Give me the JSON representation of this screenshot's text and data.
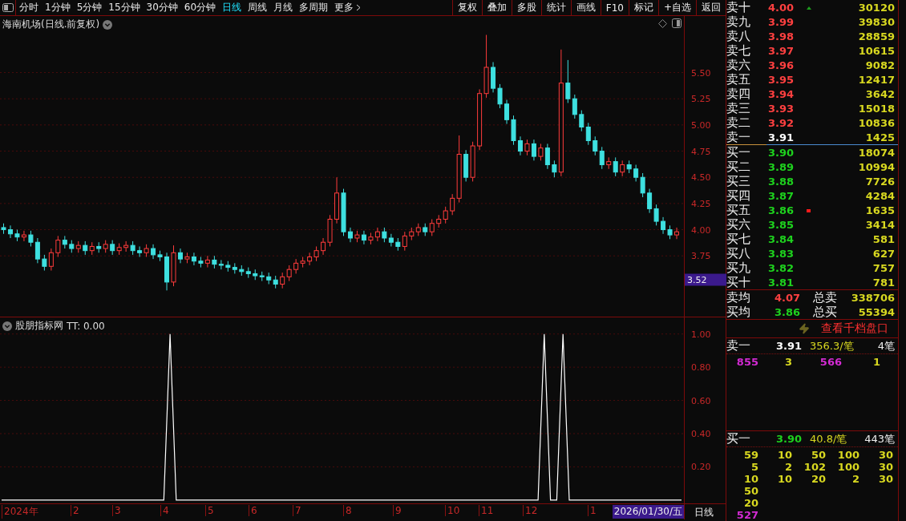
{
  "toolbar": {
    "periods": [
      {
        "label": "分时",
        "selected": false
      },
      {
        "label": "1分钟",
        "selected": false
      },
      {
        "label": "5分钟",
        "selected": false
      },
      {
        "label": "15分钟",
        "selected": false
      },
      {
        "label": "30分钟",
        "selected": false
      },
      {
        "label": "60分钟",
        "selected": false
      },
      {
        "label": "日线",
        "selected": true
      },
      {
        "label": "周线",
        "selected": false
      },
      {
        "label": "月线",
        "selected": false
      },
      {
        "label": "多周期",
        "selected": false
      },
      {
        "label": "更多",
        "selected": false
      }
    ],
    "actions": [
      "复权",
      "叠加",
      "多股",
      "统计",
      "画线",
      "F10",
      "标记",
      "+自选",
      "返回"
    ]
  },
  "main_chart": {
    "title": "海南机场(日线.前复权)",
    "current_price_label": "3.52",
    "chart_data": {
      "type": "candlestick",
      "ylim": [
        3.17,
        6.04
      ],
      "grid": true,
      "yticks": [
        {
          "value": 5.5,
          "label": "5.50"
        },
        {
          "value": 5.25,
          "label": "5.25"
        },
        {
          "value": 5,
          "label": "5.00"
        },
        {
          "value": 4.75,
          "label": "4.75"
        },
        {
          "value": 4.5,
          "label": "4.50"
        },
        {
          "value": 4.25,
          "label": "4.25"
        },
        {
          "value": 4,
          "label": "4.00"
        },
        {
          "value": 3.75,
          "label": "3.75"
        }
      ],
      "ohlc": [
        [
          4.02,
          4.06,
          3.96,
          4.0
        ],
        [
          4.0,
          4.04,
          3.92,
          3.96
        ],
        [
          3.96,
          4.0,
          3.89,
          3.93
        ],
        [
          3.93,
          3.99,
          3.89,
          3.95
        ],
        [
          3.95,
          3.99,
          3.84,
          3.88
        ],
        [
          3.88,
          3.92,
          3.68,
          3.72
        ],
        [
          3.72,
          3.76,
          3.61,
          3.65
        ],
        [
          3.65,
          3.82,
          3.61,
          3.78
        ],
        [
          3.78,
          3.94,
          3.74,
          3.9
        ],
        [
          3.9,
          3.94,
          3.82,
          3.86
        ],
        [
          3.86,
          3.9,
          3.78,
          3.82
        ],
        [
          3.82,
          3.89,
          3.78,
          3.85
        ],
        [
          3.85,
          3.89,
          3.76,
          3.8
        ],
        [
          3.8,
          3.88,
          3.76,
          3.84
        ],
        [
          3.84,
          3.88,
          3.78,
          3.82
        ],
        [
          3.82,
          3.9,
          3.78,
          3.86
        ],
        [
          3.86,
          3.9,
          3.76,
          3.8
        ],
        [
          3.8,
          3.87,
          3.76,
          3.83
        ],
        [
          3.83,
          3.89,
          3.79,
          3.85
        ],
        [
          3.85,
          3.89,
          3.76,
          3.8
        ],
        [
          3.8,
          3.84,
          3.74,
          3.78
        ],
        [
          3.78,
          3.86,
          3.74,
          3.82
        ],
        [
          3.82,
          3.86,
          3.72,
          3.76
        ],
        [
          3.76,
          3.8,
          3.7,
          3.74
        ],
        [
          3.74,
          3.78,
          3.42,
          3.5
        ],
        [
          3.5,
          3.85,
          3.46,
          3.78
        ],
        [
          3.78,
          3.82,
          3.68,
          3.72
        ],
        [
          3.72,
          3.78,
          3.68,
          3.74
        ],
        [
          3.74,
          3.78,
          3.66,
          3.7
        ],
        [
          3.7,
          3.74,
          3.64,
          3.68
        ],
        [
          3.68,
          3.75,
          3.64,
          3.71
        ],
        [
          3.71,
          3.75,
          3.63,
          3.67
        ],
        [
          3.67,
          3.71,
          3.62,
          3.66
        ],
        [
          3.66,
          3.7,
          3.6,
          3.64
        ],
        [
          3.64,
          3.68,
          3.58,
          3.62
        ],
        [
          3.62,
          3.66,
          3.56,
          3.6
        ],
        [
          3.6,
          3.64,
          3.54,
          3.58
        ],
        [
          3.58,
          3.62,
          3.52,
          3.56
        ],
        [
          3.56,
          3.6,
          3.51,
          3.55
        ],
        [
          3.55,
          3.59,
          3.48,
          3.52
        ],
        [
          3.52,
          3.56,
          3.44,
          3.48
        ],
        [
          3.48,
          3.59,
          3.44,
          3.55
        ],
        [
          3.55,
          3.66,
          3.51,
          3.62
        ],
        [
          3.62,
          3.72,
          3.58,
          3.68
        ],
        [
          3.68,
          3.74,
          3.64,
          3.7
        ],
        [
          3.7,
          3.78,
          3.66,
          3.74
        ],
        [
          3.74,
          3.84,
          3.7,
          3.8
        ],
        [
          3.8,
          3.92,
          3.76,
          3.88
        ],
        [
          3.88,
          4.14,
          3.84,
          4.1
        ],
        [
          4.1,
          4.5,
          4.06,
          4.35
        ],
        [
          4.35,
          4.39,
          3.94,
          3.98
        ],
        [
          3.98,
          4.02,
          3.88,
          3.92
        ],
        [
          3.92,
          3.99,
          3.88,
          3.95
        ],
        [
          3.95,
          3.99,
          3.86,
          3.9
        ],
        [
          3.9,
          3.97,
          3.86,
          3.93
        ],
        [
          3.93,
          4.02,
          3.89,
          3.98
        ],
        [
          3.98,
          4.02,
          3.88,
          3.92
        ],
        [
          3.92,
          3.96,
          3.84,
          3.88
        ],
        [
          3.88,
          3.92,
          3.8,
          3.84
        ],
        [
          3.84,
          3.98,
          3.8,
          3.94
        ],
        [
          3.94,
          4.02,
          3.9,
          3.98
        ],
        [
          3.98,
          4.06,
          3.94,
          4.02
        ],
        [
          4.02,
          4.06,
          3.94,
          3.98
        ],
        [
          3.98,
          4.1,
          3.94,
          4.06
        ],
        [
          4.06,
          4.14,
          4.02,
          4.1
        ],
        [
          4.1,
          4.22,
          4.06,
          4.18
        ],
        [
          4.18,
          4.34,
          4.14,
          4.3
        ],
        [
          4.3,
          4.9,
          4.26,
          4.72
        ],
        [
          4.72,
          4.76,
          4.46,
          4.5
        ],
        [
          4.5,
          4.84,
          4.46,
          4.8
        ],
        [
          4.8,
          5.34,
          4.76,
          5.3
        ],
        [
          5.3,
          5.86,
          5.26,
          5.55
        ],
        [
          5.55,
          5.6,
          5.31,
          5.35
        ],
        [
          5.35,
          5.39,
          5.16,
          5.2
        ],
        [
          5.2,
          5.24,
          5.01,
          5.05
        ],
        [
          5.05,
          5.09,
          4.81,
          4.85
        ],
        [
          4.85,
          4.89,
          4.71,
          4.75
        ],
        [
          4.75,
          4.86,
          4.71,
          4.82
        ],
        [
          4.82,
          4.86,
          4.66,
          4.7
        ],
        [
          4.7,
          4.82,
          4.66,
          4.78
        ],
        [
          4.78,
          4.82,
          4.58,
          4.62
        ],
        [
          4.62,
          4.66,
          4.5,
          4.55
        ],
        [
          4.55,
          5.72,
          4.51,
          5.4
        ],
        [
          5.4,
          5.62,
          5.21,
          5.25
        ],
        [
          5.25,
          5.29,
          5.06,
          5.1
        ],
        [
          5.1,
          5.14,
          4.94,
          4.98
        ],
        [
          4.98,
          5.02,
          4.81,
          4.85
        ],
        [
          4.85,
          4.89,
          4.71,
          4.75
        ],
        [
          4.75,
          4.79,
          4.58,
          4.62
        ],
        [
          4.62,
          4.69,
          4.58,
          4.65
        ],
        [
          4.65,
          4.69,
          4.51,
          4.55
        ],
        [
          4.55,
          4.66,
          4.51,
          4.62
        ],
        [
          4.62,
          4.66,
          4.54,
          4.58
        ],
        [
          4.58,
          4.62,
          4.46,
          4.5
        ],
        [
          4.5,
          4.54,
          4.31,
          4.35
        ],
        [
          4.35,
          4.39,
          4.16,
          4.2
        ],
        [
          4.2,
          4.24,
          4.04,
          4.08
        ],
        [
          4.08,
          4.12,
          3.96,
          4.0
        ],
        [
          4.0,
          4.04,
          3.91,
          3.95
        ],
        [
          3.95,
          4.02,
          3.91,
          3.98
        ]
      ]
    }
  },
  "indicator": {
    "name": "股朋指标网",
    "reading": "TT: 0.00",
    "chart_data": {
      "type": "line",
      "ylim": [
        -0.02,
        1.1
      ],
      "grid": true,
      "yticks": [
        {
          "value": 0.2,
          "label": "0.20"
        },
        {
          "value": 0.4,
          "label": "0.40"
        },
        {
          "value": 0.6,
          "label": "0.60"
        },
        {
          "value": 0.8,
          "label": "0.80"
        },
        {
          "value": 1,
          "label": "1.00"
        }
      ],
      "series": [
        {
          "color": "#ffffff",
          "values": [
            0,
            0,
            0,
            0,
            0,
            0,
            0,
            0,
            0,
            0,
            0,
            0,
            0,
            0,
            0,
            0,
            0,
            0,
            0,
            0,
            0,
            0,
            0,
            0,
            0,
            0,
            0,
            1,
            0,
            0,
            0,
            0,
            0,
            0,
            0,
            0,
            0,
            0,
            0,
            0,
            0,
            0,
            0,
            0,
            0,
            0,
            0,
            0,
            0,
            0,
            0,
            0,
            0,
            0,
            0,
            0,
            0,
            0,
            0,
            0,
            0,
            0,
            0,
            0,
            0,
            0,
            0,
            0,
            0,
            0,
            0,
            0,
            0,
            0,
            0,
            0,
            0,
            0,
            0,
            0,
            0,
            0,
            0,
            0,
            0,
            0,
            0,
            1,
            0,
            0,
            1,
            0,
            0,
            0,
            0,
            0,
            0,
            0,
            0,
            0,
            0,
            0,
            0,
            0,
            0,
            0,
            0,
            0,
            0,
            0
          ]
        }
      ]
    }
  },
  "time_axis": {
    "labels": [
      "2024年",
      "2",
      "3",
      "4",
      "5",
      "6",
      "7",
      "8",
      "9",
      "10",
      "11",
      "12",
      "1"
    ],
    "cursor_date": "2026/01/30/五",
    "period": "日线"
  },
  "order_book": {
    "asks": [
      {
        "label": "卖十",
        "price": "4.00",
        "volume": "30120",
        "color": "#ff4040",
        "rise_mark": true,
        "alert_mark": false
      },
      {
        "label": "卖九",
        "price": "3.99",
        "volume": "39830",
        "color": "#ff4040",
        "rise_mark": false,
        "alert_mark": false
      },
      {
        "label": "卖八",
        "price": "3.98",
        "volume": "28859",
        "color": "#ff4040",
        "rise_mark": false,
        "alert_mark": false
      },
      {
        "label": "卖七",
        "price": "3.97",
        "volume": "10615",
        "color": "#ff4040",
        "rise_mark": false,
        "alert_mark": false
      },
      {
        "label": "卖六",
        "price": "3.96",
        "volume": "9082",
        "color": "#ff4040",
        "rise_mark": false,
        "alert_mark": false
      },
      {
        "label": "卖五",
        "price": "3.95",
        "volume": "12417",
        "color": "#ff4040",
        "rise_mark": false,
        "alert_mark": false
      },
      {
        "label": "卖四",
        "price": "3.94",
        "volume": "3642",
        "color": "#ff4040",
        "rise_mark": false,
        "alert_mark": false
      },
      {
        "label": "卖三",
        "price": "3.93",
        "volume": "15018",
        "color": "#ff4040",
        "rise_mark": false,
        "alert_mark": false
      },
      {
        "label": "卖二",
        "price": "3.92",
        "volume": "10836",
        "color": "#ff4040",
        "rise_mark": false,
        "alert_mark": false
      },
      {
        "label": "卖一",
        "price": "3.91",
        "volume": "1425",
        "color": "#ffffff",
        "rise_mark": false,
        "alert_mark": false
      }
    ],
    "bids": [
      {
        "label": "买一",
        "price": "3.90",
        "volume": "18074",
        "color": "#1ed21e",
        "rise_mark": false,
        "alert_mark": false
      },
      {
        "label": "买二",
        "price": "3.89",
        "volume": "10994",
        "color": "#1ed21e",
        "rise_mark": false,
        "alert_mark": false
      },
      {
        "label": "买三",
        "price": "3.88",
        "volume": "7726",
        "color": "#1ed21e",
        "rise_mark": false,
        "alert_mark": false
      },
      {
        "label": "买四",
        "price": "3.87",
        "volume": "4284",
        "color": "#1ed21e",
        "rise_mark": false,
        "alert_mark": false
      },
      {
        "label": "买五",
        "price": "3.86",
        "volume": "1635",
        "color": "#1ed21e",
        "rise_mark": false,
        "alert_mark": true
      },
      {
        "label": "买六",
        "price": "3.85",
        "volume": "3414",
        "color": "#1ed21e",
        "rise_mark": false,
        "alert_mark": false
      },
      {
        "label": "买七",
        "price": "3.84",
        "volume": "581",
        "color": "#1ed21e",
        "rise_mark": false,
        "alert_mark": false
      },
      {
        "label": "买八",
        "price": "3.83",
        "volume": "627",
        "color": "#1ed21e",
        "rise_mark": false,
        "alert_mark": false
      },
      {
        "label": "买九",
        "price": "3.82",
        "volume": "757",
        "color": "#1ed21e",
        "rise_mark": false,
        "alert_mark": false
      },
      {
        "label": "买十",
        "price": "3.81",
        "volume": "781",
        "color": "#1ed21e",
        "rise_mark": false,
        "alert_mark": false
      }
    ],
    "summary": [
      {
        "label": "卖均",
        "price": "4.07",
        "color": "#ff4040",
        "total_label": "总卖",
        "total": "338706"
      },
      {
        "label": "买均",
        "price": "3.86",
        "color": "#1ed21e",
        "total_label": "总买",
        "total": "55394"
      }
    ]
  },
  "thousand_levels_link": "查看千档盘口",
  "queues": [
    {
      "label": "卖一",
      "price": "3.91",
      "color": "#ffffff",
      "average": "356.3/笔",
      "count": "4笔",
      "rows": [
        [
          {
            "value": "855",
            "large": true
          },
          {
            "value": "3",
            "large": false
          },
          {
            "value": "566",
            "large": true
          },
          {
            "value": "1",
            "large": false
          }
        ]
      ]
    },
    {
      "label": "买一",
      "price": "3.90",
      "color": "#1ed21e",
      "average": "40.8/笔",
      "count": "443笔",
      "rows": [
        [
          {
            "value": "59",
            "large": false
          },
          {
            "value": "10",
            "large": false
          },
          {
            "value": "50",
            "large": false
          },
          {
            "value": "100",
            "large": false
          },
          {
            "value": "30",
            "large": false
          }
        ],
        [
          {
            "value": "5",
            "large": false
          },
          {
            "value": "2",
            "large": false
          },
          {
            "value": "102",
            "large": false
          },
          {
            "value": "100",
            "large": false
          },
          {
            "value": "30",
            "large": false
          }
        ],
        [
          {
            "value": "10",
            "large": false
          },
          {
            "value": "10",
            "large": false
          },
          {
            "value": "20",
            "large": false
          },
          {
            "value": "2",
            "large": false
          },
          {
            "value": "30",
            "large": false
          }
        ],
        [
          {
            "value": "50",
            "large": false
          }
        ],
        [
          {
            "value": "20",
            "large": false
          }
        ],
        [
          {
            "value": "527",
            "large": true
          }
        ]
      ]
    }
  ]
}
